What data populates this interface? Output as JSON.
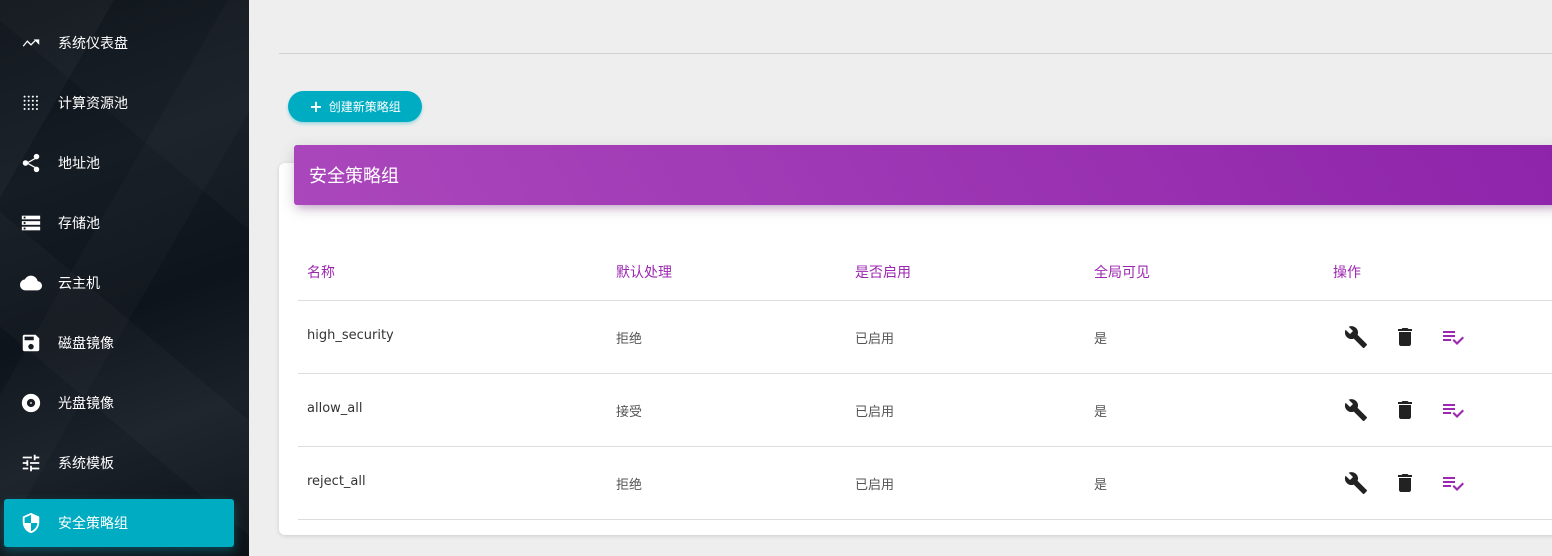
{
  "sidebar": {
    "items": [
      {
        "label": "系统仪表盘",
        "icon": "trending-icon"
      },
      {
        "label": "计算资源池",
        "icon": "grid-dots-icon"
      },
      {
        "label": "地址池",
        "icon": "share-icon"
      },
      {
        "label": "存储池",
        "icon": "storage-list-icon"
      },
      {
        "label": "云主机",
        "icon": "cloud-icon"
      },
      {
        "label": "磁盘镜像",
        "icon": "save-icon"
      },
      {
        "label": "光盘镜像",
        "icon": "disc-icon"
      },
      {
        "label": "系统模板",
        "icon": "sliders-icon"
      },
      {
        "label": "安全策略组",
        "icon": "shield-icon"
      }
    ],
    "active_index": 8,
    "accent_color": "#00acc1"
  },
  "toolbar": {
    "create_label": "创建新策略组"
  },
  "card": {
    "title": "安全策略组",
    "header_color": "#9c27b0"
  },
  "table": {
    "headers": [
      "名称",
      "默认处理",
      "是否启用",
      "全局可见",
      "操作"
    ],
    "rows": [
      {
        "name": "high_security",
        "default_action": "拒绝",
        "enabled": "已启用",
        "global": "是"
      },
      {
        "name": "allow_all",
        "default_action": "接受",
        "enabled": "已启用",
        "global": "是"
      },
      {
        "name": "reject_all",
        "default_action": "拒绝",
        "enabled": "已启用",
        "global": "是"
      }
    ],
    "actions": [
      "wrench-icon",
      "trash-icon",
      "playlist-check-icon"
    ]
  }
}
